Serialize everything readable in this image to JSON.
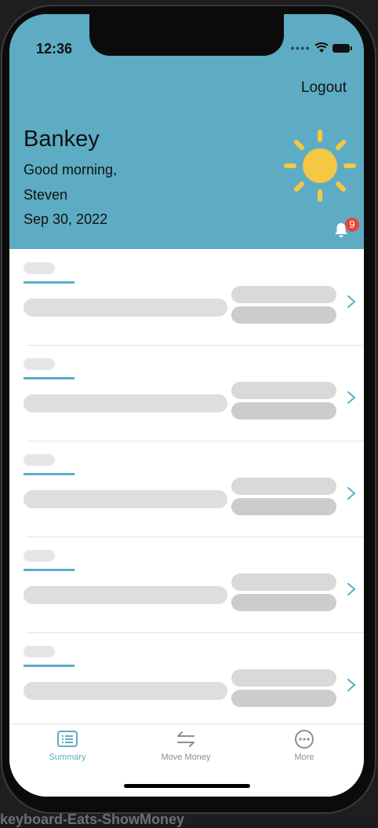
{
  "status_bar": {
    "time": "12:36"
  },
  "header": {
    "logout_label": "Logout",
    "app_title": "Bankey",
    "greeting": "Good morning,",
    "user_name": "Steven",
    "date": "Sep 30, 2022",
    "weather_icon": "sun-icon",
    "notification_count": "9"
  },
  "accounts_list": {
    "placeholder_rows": 5
  },
  "tab_bar": {
    "tabs": [
      {
        "label": "Summary",
        "icon": "summary-icon",
        "selected": true
      },
      {
        "label": "Move Money",
        "icon": "arrows-left-right-icon",
        "selected": false
      },
      {
        "label": "More",
        "icon": "ellipsis-circle-icon",
        "selected": false
      }
    ]
  },
  "colors": {
    "accent": "#5eacc4",
    "header_bg": "#5eacc4",
    "sun": "#f5c842",
    "badge": "#e5453a",
    "tab_inactive": "#8e8e93"
  },
  "caption_text": "keyboard-Eats-ShowMoney"
}
